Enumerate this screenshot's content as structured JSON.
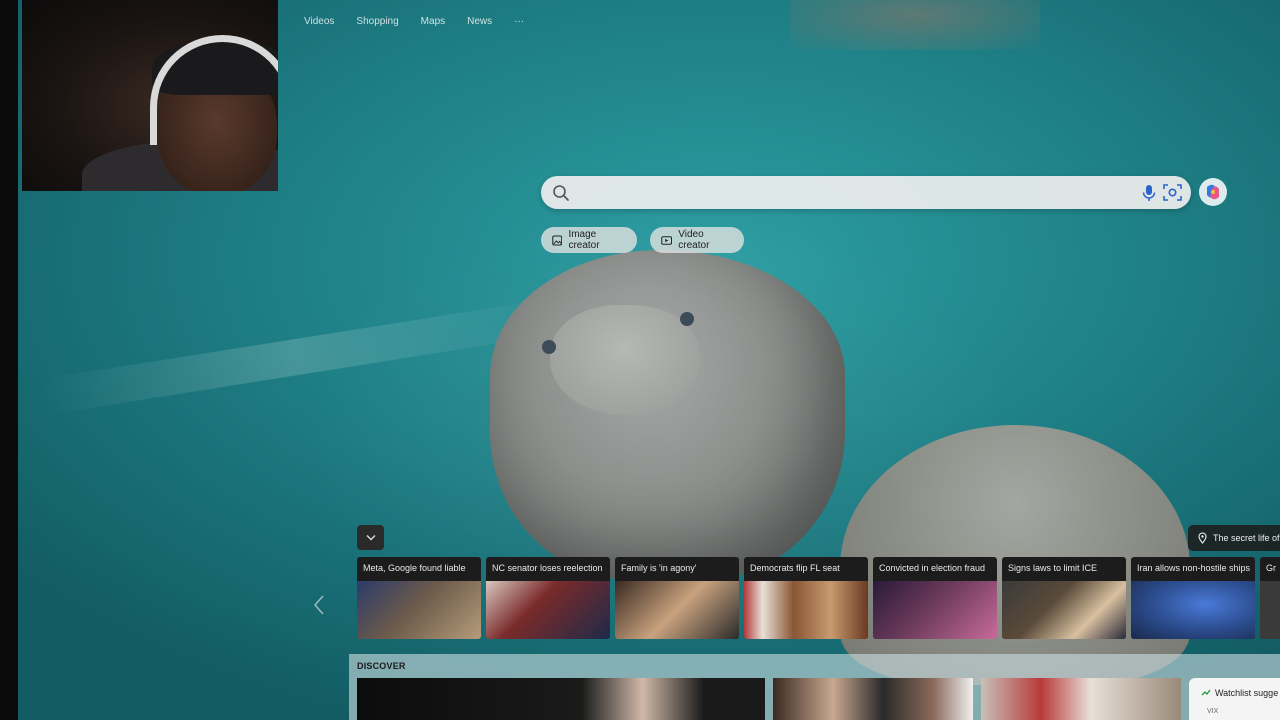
{
  "nav": {
    "items": [
      "Videos",
      "Shopping",
      "Maps",
      "News"
    ],
    "more_label": "···"
  },
  "search": {
    "value": "",
    "placeholder": ""
  },
  "tools": {
    "image_creator": "Image creator",
    "video_creator": "Video creator"
  },
  "location": {
    "text": "The secret life of"
  },
  "news": [
    {
      "title": "Meta, Google found liable",
      "color": "#6b5a4a"
    },
    {
      "title": "NC senator loses reelection",
      "color": "#7a2a2a"
    },
    {
      "title": "Family is 'in agony'",
      "color": "#8a6a52"
    },
    {
      "title": "Democrats flip FL seat",
      "color": "#8a5634"
    },
    {
      "title": "Convicted in election fraud",
      "color": "#6a3a5a"
    },
    {
      "title": "Signs laws to limit ICE",
      "color": "#5a4a3a"
    },
    {
      "title": "Iran allows non-hostile ships",
      "color": "#2a4a8a"
    },
    {
      "title": "Gr",
      "color": "#3a3a3a"
    }
  ],
  "discover": {
    "label": "DISCOVER",
    "watchlist_title": "Watchlist sugge",
    "watchlist_sub": "VIX"
  },
  "colors": {
    "water": "#1f8288",
    "card_bg": "#1c1c1c",
    "pill_bg": "#e1e1e1"
  }
}
